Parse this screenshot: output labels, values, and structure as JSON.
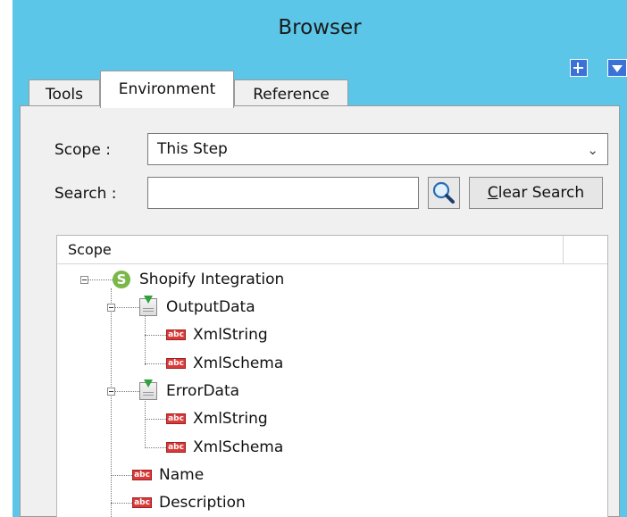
{
  "window": {
    "title": "Browser"
  },
  "tabs": [
    {
      "label": "Tools",
      "selected": false
    },
    {
      "label": "Environment",
      "selected": true
    },
    {
      "label": "Reference",
      "selected": false
    }
  ],
  "form": {
    "scope_label": "Scope :",
    "scope_value": "This Step",
    "search_label": "Search :",
    "search_value": "",
    "clear_search_prefix": "C",
    "clear_search_rest": "lear Search"
  },
  "tree": {
    "column_header": "Scope",
    "root": {
      "label": "Shopify Integration",
      "icon": "shopify-icon"
    },
    "output": {
      "label": "OutputData",
      "icon": "document-icon"
    },
    "output_children": [
      "XmlString",
      "XmlSchema"
    ],
    "error": {
      "label": "ErrorData",
      "icon": "document-icon"
    },
    "error_children": [
      "XmlString",
      "XmlSchema"
    ],
    "fields": [
      "Name",
      "Description"
    ]
  },
  "icons": {
    "abc_label": "abc"
  },
  "colors": {
    "window_accent": "#5bc6e8",
    "shopify": "#7ab648",
    "string_icon": "#d93a3a"
  }
}
